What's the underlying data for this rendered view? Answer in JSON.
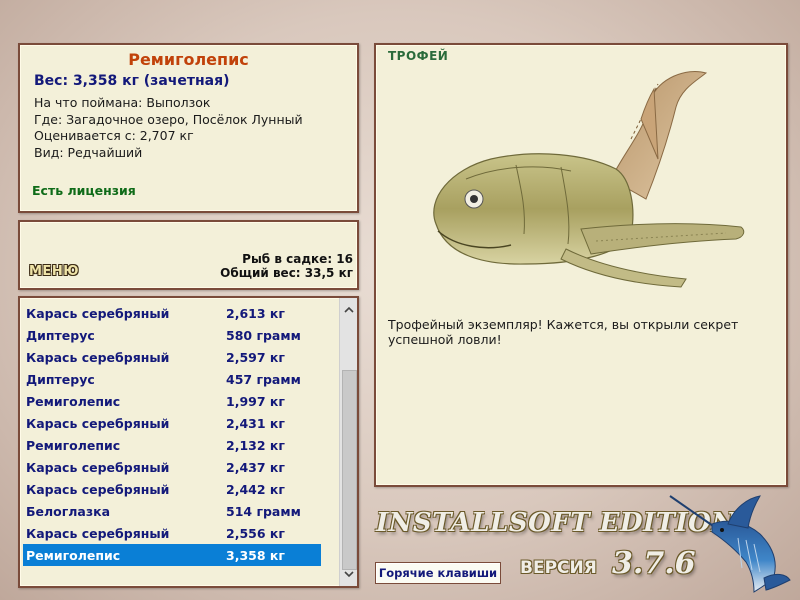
{
  "info": {
    "fish_name": "Ремиголепис",
    "weight_line": "Вес: 3,358 кг (зачетная)",
    "caught_on": "На что поймана: Выползок",
    "location": "Где: Загадочное озеро, Посёлок Лунный",
    "valued_from": "Оценивается с: 2,707 кг",
    "kind": "Вид: Редчайший",
    "license": "Есть лицензия"
  },
  "menu": {
    "menu_label": "МЕНЮ",
    "fish_count": "Рыб в садке: 16",
    "total_weight": "Общий вес: 33,5 кг"
  },
  "catch_list": {
    "rows": [
      {
        "name": "Карась серебряный",
        "weight": "2,613 кг"
      },
      {
        "name": "Диптерус",
        "weight": "580 грамм"
      },
      {
        "name": "Карась серебряный",
        "weight": "2,597 кг"
      },
      {
        "name": "Диптерус",
        "weight": "457 грамм"
      },
      {
        "name": "Ремиголепис",
        "weight": "1,997 кг"
      },
      {
        "name": "Карась серебряный",
        "weight": "2,431 кг"
      },
      {
        "name": "Ремиголепис",
        "weight": "2,132 кг"
      },
      {
        "name": "Карась серебряный",
        "weight": "2,437 кг"
      },
      {
        "name": "Карась серебряный",
        "weight": "2,442 кг"
      },
      {
        "name": "Белоглазка",
        "weight": "514 грамм"
      },
      {
        "name": "Карась серебряный",
        "weight": "2,556 кг"
      },
      {
        "name": "Ремиголепис",
        "weight": "3,358 кг"
      }
    ],
    "selected_index": 11
  },
  "trophy": {
    "title": "ТРОФЕЙ",
    "description": "Трофейный экземпляр! Кажется, вы открыли секрет успешной ловли!"
  },
  "hotkeys_label": "Горячие клавиши",
  "brand": {
    "edition": "INSTALLSOFT EDITION",
    "version_label": "ВЕРСИЯ",
    "version_number": "3.7.6"
  },
  "icons": {
    "scroll_up": "chevron-up-icon",
    "scroll_down": "chevron-down-icon",
    "logo": "marlin-logo-icon",
    "trophy_image": "remigolepis-fish-image"
  },
  "colors": {
    "panel_bg": "#f3f0d9",
    "panel_border": "#7a4b3a",
    "fish_name": "#c1420a",
    "list_text": "#13197a",
    "license": "#0e6b18",
    "selection": "#0a7fd6"
  }
}
